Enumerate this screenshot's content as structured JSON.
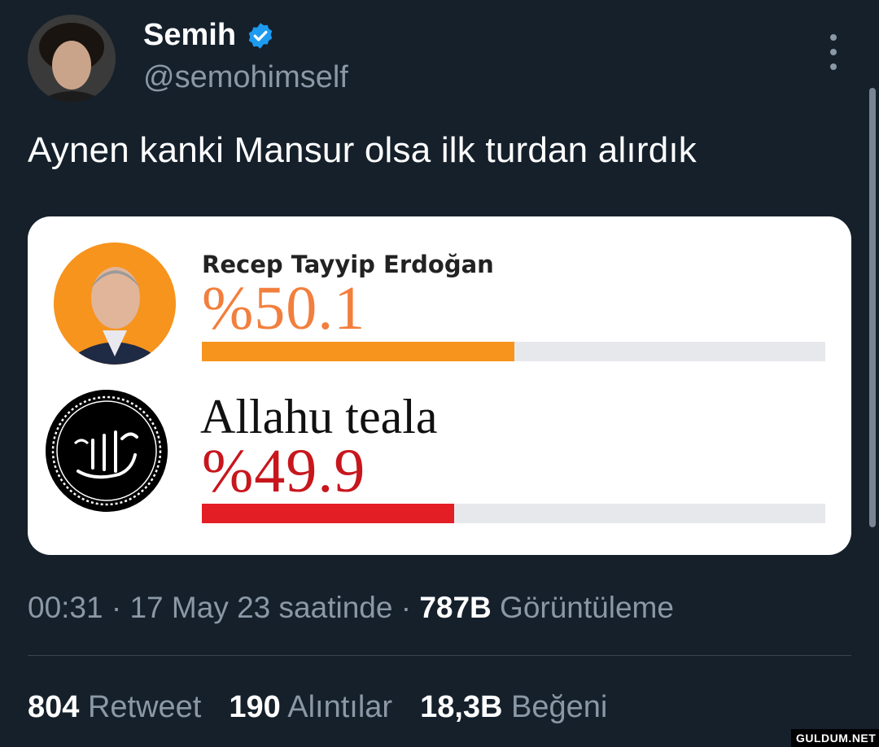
{
  "author": {
    "display_name": "Semih",
    "handle": "@semohimself",
    "verified": true
  },
  "tweet": {
    "text": "Aynen kanki Mansur olsa ilk turdan alırdık"
  },
  "media": {
    "candidates": [
      {
        "name": "Recep Tayyip Erdoğan",
        "percent_label": "%50.1",
        "share": 0.501,
        "bar_color": "#f7941d"
      },
      {
        "name": "Allahu teala",
        "percent_label": "%49.9",
        "share": 0.499,
        "bar_color": "#e31e24"
      }
    ]
  },
  "meta": {
    "time": "00:31",
    "sep1": " · ",
    "date": "17 May 23 saatinde",
    "sep2": " · ",
    "views_count": "787B",
    "views_label": " Görüntüleme"
  },
  "stats": {
    "retweets": {
      "count": "804",
      "label": " Retweet"
    },
    "quotes": {
      "count": "190",
      "label": " Alıntılar"
    },
    "likes": {
      "count": "18,3B",
      "label": " Beğeni"
    }
  },
  "watermark": "GULDUM.NET",
  "colors": {
    "background": "#15202b",
    "secondary_text": "#8b98a5",
    "verified_blue": "#1d9bf0"
  },
  "icons": {
    "verified": "verified-badge-icon",
    "more": "more-options-icon"
  }
}
